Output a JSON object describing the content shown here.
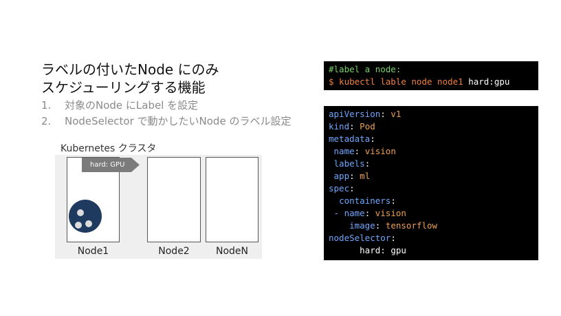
{
  "title": {
    "line1": "ラベルの付いたNode にのみ",
    "line2": "スケジューリングする機能"
  },
  "steps": [
    {
      "num": "1.",
      "text": "対象のNode にLabel を設定"
    },
    {
      "num": "2.",
      "text": "NodeSelector で動かしたいNode のラベル設定"
    }
  ],
  "cluster": {
    "label": "Kubernetes クラスタ",
    "tag": "hard:  GPU",
    "nodes": [
      "Node1",
      "Node2",
      "NodeN"
    ]
  },
  "command": {
    "comment": "#label a node:",
    "cmd": "$ kubectl lable node node1 ",
    "arg": "hard:gpu"
  },
  "yaml": {
    "apiVersion_key": "apiVersion",
    "apiVersion_val": "v1",
    "kind_key": "kind",
    "kind_val": "Pod",
    "metadata_key": "metadata",
    "name_key": "name",
    "name_val": "vision",
    "labels_key": "labels",
    "app_key": "app",
    "app_val": "ml",
    "spec_key": "spec",
    "containers_key": "containers",
    "cname_key": "- name",
    "cname_val": "vision",
    "image_key": "image",
    "image_val": "tensorflow",
    "nodeSelector_key": "nodeSelector",
    "hard_key": "hard",
    "hard_val": "gpu"
  },
  "colors": {
    "comment": "#7ad36b",
    "prompt": "#f08040",
    "key": "#6fa8ff",
    "value": "#f0a050",
    "pod": "#1f3a5f",
    "tag": "#7b7b7b"
  }
}
